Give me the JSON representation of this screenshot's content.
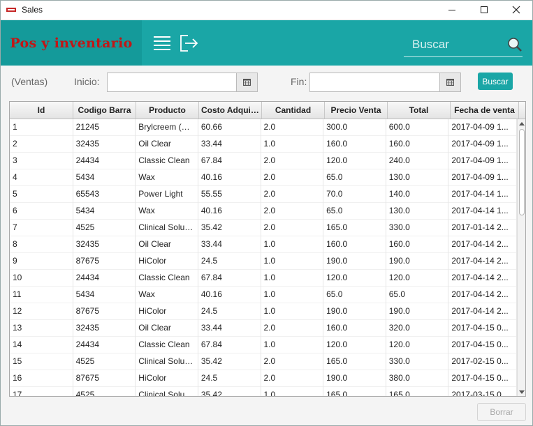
{
  "window": {
    "title": "Sales"
  },
  "header": {
    "brand": "Pos y inventario",
    "search_placeholder": "Buscar"
  },
  "filters": {
    "section_label": "(Ventas)",
    "start_label": "Inicio:",
    "start_value": "",
    "end_label": "Fin:",
    "end_value": "",
    "search_button": "Buscar"
  },
  "table": {
    "columns": [
      "Id",
      "Codigo Barra",
      "Producto",
      "Costo Adquis...",
      "Cantidad",
      "Precio Venta",
      "Total",
      "Fecha de venta"
    ],
    "rows": [
      [
        "1",
        "21245",
        "Brylcreem (Red)",
        "60.66",
        "2.0",
        "300.0",
        "600.0",
        "2017-04-09 1..."
      ],
      [
        "2",
        "32435",
        "Oil Clear",
        "33.44",
        "1.0",
        "160.0",
        "160.0",
        "2017-04-09 1..."
      ],
      [
        "3",
        "24434",
        "Classic Clean",
        "67.84",
        "2.0",
        "120.0",
        "240.0",
        "2017-04-09 1..."
      ],
      [
        "4",
        "5434",
        "Wax",
        "40.16",
        "2.0",
        "65.0",
        "130.0",
        "2017-04-09 1..."
      ],
      [
        "5",
        "65543",
        "Power Light",
        "55.55",
        "2.0",
        "70.0",
        "140.0",
        "2017-04-14 1..."
      ],
      [
        "6",
        "5434",
        "Wax",
        "40.16",
        "2.0",
        "65.0",
        "130.0",
        "2017-04-14 1..."
      ],
      [
        "7",
        "4525",
        "Clinical Soluti...",
        "35.42",
        "2.0",
        "165.0",
        "330.0",
        "2017-01-14 2..."
      ],
      [
        "8",
        "32435",
        "Oil Clear",
        "33.44",
        "1.0",
        "160.0",
        "160.0",
        "2017-04-14 2..."
      ],
      [
        "9",
        "87675",
        "HiColor",
        "24.5",
        "1.0",
        "190.0",
        "190.0",
        "2017-04-14 2..."
      ],
      [
        "10",
        "24434",
        "Classic Clean",
        "67.84",
        "1.0",
        "120.0",
        "120.0",
        "2017-04-14 2..."
      ],
      [
        "11",
        "5434",
        "Wax",
        "40.16",
        "1.0",
        "65.0",
        "65.0",
        "2017-04-14 2..."
      ],
      [
        "12",
        "87675",
        "HiColor",
        "24.5",
        "1.0",
        "190.0",
        "190.0",
        "2017-04-14 2..."
      ],
      [
        "13",
        "32435",
        "Oil Clear",
        "33.44",
        "2.0",
        "160.0",
        "320.0",
        "2017-04-15 0..."
      ],
      [
        "14",
        "24434",
        "Classic Clean",
        "67.84",
        "1.0",
        "120.0",
        "120.0",
        "2017-04-15 0..."
      ],
      [
        "15",
        "4525",
        "Clinical Soluti...",
        "35.42",
        "2.0",
        "165.0",
        "330.0",
        "2017-02-15 0..."
      ],
      [
        "16",
        "87675",
        "HiColor",
        "24.5",
        "2.0",
        "190.0",
        "380.0",
        "2017-04-15 0..."
      ],
      [
        "17",
        "4525",
        "Clinical Soluti...",
        "35.42",
        "1.0",
        "165.0",
        "165.0",
        "2017-03-15 0..."
      ]
    ]
  },
  "footer": {
    "delete_button": "Borrar"
  },
  "icons": {
    "menu": "hamburger-menu-icon",
    "logout": "logout-icon",
    "search": "magnifier-icon",
    "calendar": "calendar-icon"
  },
  "colors": {
    "header": "#1aa6a6",
    "brand_bg": "#149a9a",
    "brand_text": "#c21616",
    "accent": "#1aa6a6"
  }
}
